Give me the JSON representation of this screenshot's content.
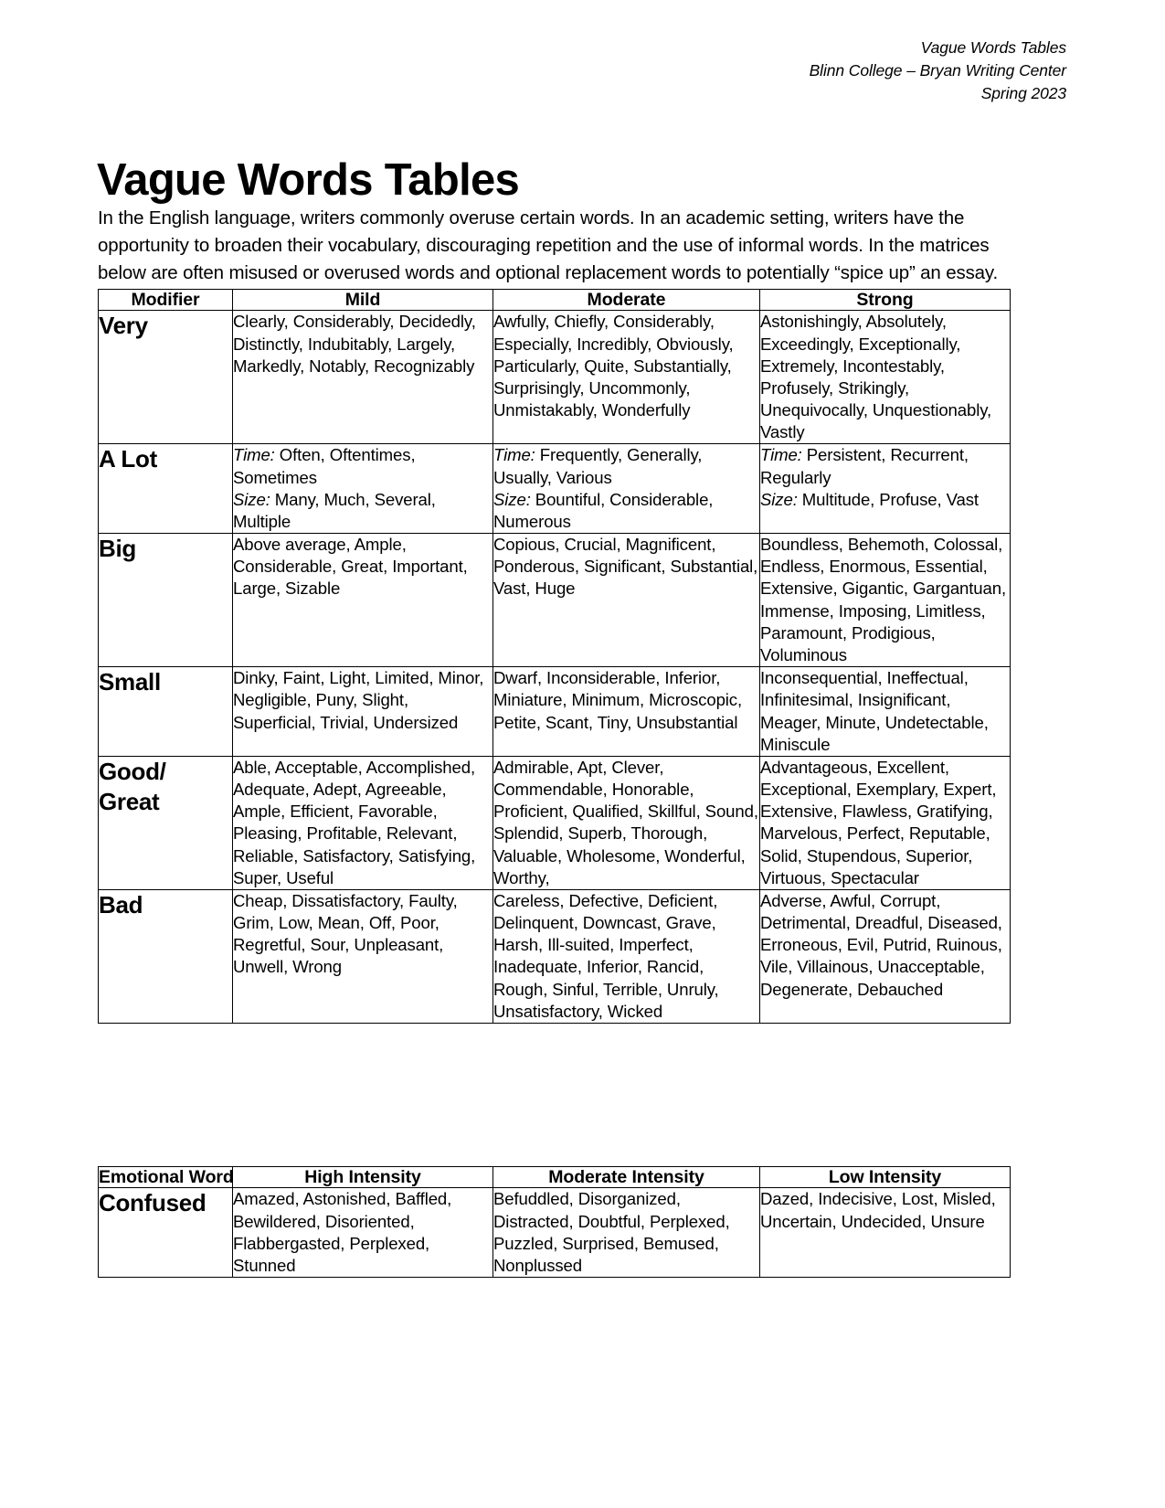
{
  "doc_header": {
    "line1": "Vague Words Tables",
    "line2": "Blinn College – Bryan Writing Center",
    "line3": "Spring 2023"
  },
  "title": "Vague Words Tables",
  "intro": "In the English language, writers commonly overuse certain words. In an academic setting, writers have the opportunity to broaden their vocabulary, discouraging repetition and the use of informal words. In the matrices below are often misused or overused words and optional replacement words to potentially “spice up” an essay.",
  "modifier_table": {
    "headers": [
      "Modifier",
      "Mild",
      "Moderate",
      "Strong"
    ],
    "rows": [
      {
        "modifier": "Very",
        "mild": "Clearly, Considerably, Decidedly, Distinctly, Indubitably, Largely, Markedly, Notably, Recognizably",
        "moderate": "Awfully, Chiefly, Considerably, Especially, Incredibly, Obviously, Particularly, Quite, Substantially, Surprisingly, Uncommonly, Unmistakably, Wonderfully",
        "strong": "Astonishingly, Absolutely, Exceedingly, Exceptionally, Extremely, Incontestably, Profusely, Strikingly, Unequivocally, Unquestionably, Vastly"
      },
      {
        "modifier": "A Lot",
        "mild_time_label": "Time:",
        "mild_time": " Often, Oftentimes, Sometimes",
        "mild_size_label": "Size:",
        "mild_size": " Many, Much, Several, Multiple",
        "moderate_time_label": "Time:",
        "moderate_time": " Frequently, Generally, Usually, Various",
        "moderate_size_label": "Size:",
        "moderate_size": " Bountiful, Considerable, Numerous",
        "strong_time_label": "Time:",
        "strong_time": " Persistent, Recurrent, Regularly",
        "strong_size_label": "Size:",
        "strong_size": " Multitude, Profuse, Vast"
      },
      {
        "modifier": "Big",
        "mild": "Above average, Ample, Considerable, Great, Important, Large, Sizable",
        "moderate": "Copious, Crucial, Magnificent, Ponderous, Significant, Substantial, Vast, Huge",
        "strong": "Boundless, Behemoth, Colossal, Endless, Enormous, Essential, Extensive, Gigantic, Gargantuan, Immense, Imposing, Limitless, Paramount, Prodigious, Voluminous"
      },
      {
        "modifier": "Small",
        "mild": "Dinky, Faint, Light, Limited, Minor, Negligible, Puny, Slight, Superficial, Trivial, Undersized",
        "moderate": "Dwarf, Inconsiderable, Inferior, Miniature, Minimum, Microscopic, Petite, Scant, Tiny, Unsubstantial",
        "strong": "Inconsequential, Ineffectual, Infinitesimal, Insignificant, Meager, Minute, Undetectable, Miniscule"
      },
      {
        "modifier": "Good/ Great",
        "mild": "Able, Acceptable, Accomplished, Adequate, Adept, Agreeable, Ample, Efficient, Favorable, Pleasing, Profitable, Relevant, Reliable, Satisfactory, Satisfying, Super, Useful",
        "moderate": "Admirable, Apt, Clever, Commendable, Honorable, Proficient, Qualified, Skillful, Sound, Splendid, Superb, Thorough, Valuable, Wholesome, Wonderful, Worthy,",
        "strong": "Advantageous, Excellent, Exceptional, Exemplary, Expert, Extensive, Flawless, Gratifying, Marvelous, Perfect, Reputable, Solid, Stupendous, Superior, Virtuous, Spectacular"
      },
      {
        "modifier": "Bad",
        "mild": "Cheap, Dissatisfactory, Faulty, Grim, Low, Mean, Off, Poor, Regretful, Sour, Unpleasant, Unwell, Wrong",
        "moderate": "Careless, Defective, Deficient, Delinquent, Downcast, Grave, Harsh, Ill-suited, Imperfect, Inadequate, Inferior, Rancid, Rough, Sinful, Terrible, Unruly, Unsatisfactory, Wicked",
        "strong": "Adverse, Awful, Corrupt, Detrimental, Dreadful, Diseased, Erroneous, Evil, Putrid, Ruinous, Vile, Villainous, Unacceptable, Degenerate, Debauched"
      }
    ]
  },
  "emotion_table": {
    "headers": [
      "Emotional Word",
      "High Intensity",
      "Moderate Intensity",
      "Low Intensity"
    ],
    "rows": [
      {
        "word": "Confused",
        "high": "Amazed, Astonished, Baffled, Bewildered, Disoriented, Flabbergasted, Perplexed, Stunned",
        "moderate": "Befuddled, Disorganized, Distracted, Doubtful, Perplexed, Puzzled, Surprised, Bemused, Nonplussed",
        "low": "Dazed, Indecisive, Lost, Misled, Uncertain, Undecided, Unsure"
      }
    ]
  }
}
